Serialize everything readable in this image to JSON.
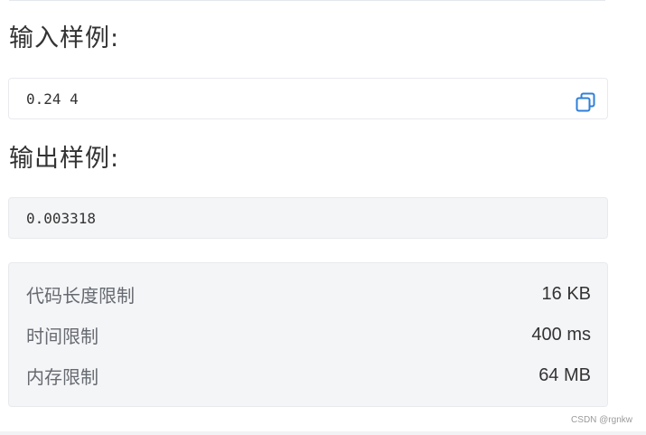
{
  "sample_input": {
    "heading": "输入样例:",
    "content": "0.24 4",
    "copy_icon": "copy-icon"
  },
  "sample_output": {
    "heading": "输出样例:",
    "content": "0.003318"
  },
  "limits": [
    {
      "label": "代码长度限制",
      "value": "16 KB"
    },
    {
      "label": "时间限制",
      "value": "400 ms"
    },
    {
      "label": "内存限制",
      "value": "64 MB"
    }
  ],
  "watermark": "CSDN @rgnkw",
  "colors": {
    "accent": "#2f7fd8",
    "panel_bg": "#f4f5f7",
    "border": "#e8eaee"
  }
}
